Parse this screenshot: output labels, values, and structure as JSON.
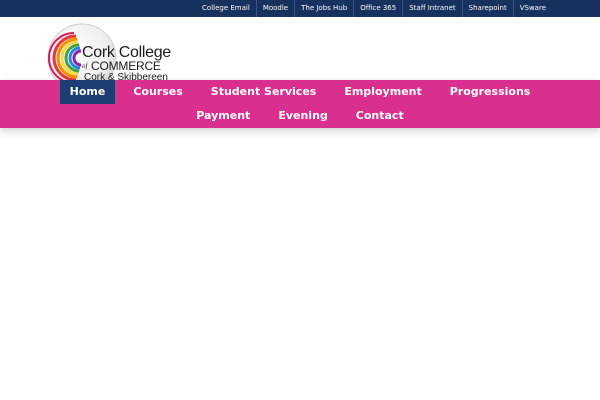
{
  "topbar": {
    "links": [
      "College Email",
      "Moodle",
      "The Jobs Hub",
      "Office 365",
      "Staff Intranet",
      "Sharepoint",
      "VSware"
    ]
  },
  "logo": {
    "line1": "Cork College",
    "of": "of",
    "line2": "COMMERCE",
    "line3": "Cork & Skibbereen"
  },
  "nav": {
    "row1": [
      "Home",
      "Courses",
      "Student Services",
      "Employment",
      "Progressions"
    ],
    "row2": [
      "Payment",
      "Evening",
      "Contact"
    ],
    "active": "Home"
  },
  "colors": {
    "topbar": "#17325e",
    "navbar": "#d92f8e",
    "active_tab": "#1e3d73"
  }
}
